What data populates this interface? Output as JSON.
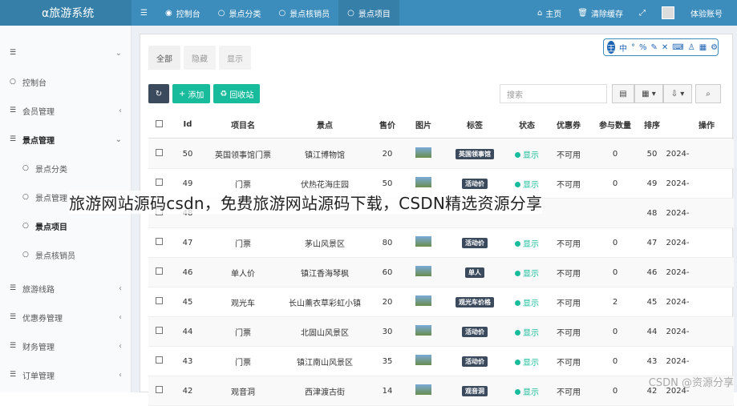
{
  "header": {
    "logo": "α旅游系统",
    "nav": [
      {
        "icon": "dashboard-icon",
        "label": "控制台"
      },
      {
        "icon": "circle-icon",
        "label": "景点分类"
      },
      {
        "icon": "circle-icon",
        "label": "景点核销员"
      },
      {
        "icon": "circle-icon",
        "label": "景点项目"
      }
    ],
    "right": {
      "home": "主页",
      "clear_cache": "清除缓存",
      "account": "体验账号"
    }
  },
  "sidebar": {
    "items": [
      {
        "label": "控制台"
      },
      {
        "label": "会员管理"
      },
      {
        "label": "景点管理"
      },
      {
        "label": "景点分类"
      },
      {
        "label": "景点管理"
      },
      {
        "label": "景点项目"
      },
      {
        "label": "景点核销员"
      },
      {
        "label": "旅游线路"
      },
      {
        "label": "优惠券管理"
      },
      {
        "label": "财务管理"
      },
      {
        "label": "订单管理"
      }
    ]
  },
  "tabs": [
    "全部",
    "隐藏",
    "显示"
  ],
  "toolbar": {
    "add": "添加",
    "recycle": "回收站",
    "search_placeholder": "搜索"
  },
  "table": {
    "headers": [
      "Id",
      "项目名",
      "景点",
      "售价",
      "图片",
      "标签",
      "状态",
      "优惠券",
      "参与数量",
      "排序",
      "操作"
    ],
    "rows": [
      {
        "id": "50",
        "name": "英国领事馆门票",
        "spot": "镇江博物馆",
        "price": "20",
        "tag": "英国领事馆",
        "status": "显示",
        "coupon": "不可用",
        "count": "0",
        "sort": "50",
        "time": "2024-"
      },
      {
        "id": "49",
        "name": "门票",
        "spot": "伏热花海庄园",
        "price": "50",
        "tag": "活动价",
        "status": "显示",
        "coupon": "不可用",
        "count": "0",
        "sort": "49",
        "time": "2024-"
      },
      {
        "id": "48",
        "name": "",
        "spot": "",
        "price": "",
        "tag": "",
        "status": "",
        "coupon": "",
        "count": "",
        "sort": "48",
        "time": "2024-"
      },
      {
        "id": "47",
        "name": "门票",
        "spot": "茅山风景区",
        "price": "80",
        "tag": "活动价",
        "status": "显示",
        "coupon": "不可用",
        "count": "0",
        "sort": "47",
        "time": "2024-"
      },
      {
        "id": "46",
        "name": "单人价",
        "spot": "镇江香海琴枫",
        "price": "60",
        "tag": "单人",
        "status": "显示",
        "coupon": "不可用",
        "count": "0",
        "sort": "46",
        "time": "2024-"
      },
      {
        "id": "45",
        "name": "观光车",
        "spot": "长山薰衣草彩虹小镇",
        "price": "20",
        "tag": "观光车价格",
        "status": "显示",
        "coupon": "不可用",
        "count": "2",
        "sort": "45",
        "time": "2024-"
      },
      {
        "id": "44",
        "name": "门票",
        "spot": "北固山风景区",
        "price": "30",
        "tag": "活动价",
        "status": "显示",
        "coupon": "不可用",
        "count": "0",
        "sort": "44",
        "time": "2024-"
      },
      {
        "id": "43",
        "name": "门票",
        "spot": "镇江南山风景区",
        "price": "35",
        "tag": "活动价",
        "status": "显示",
        "coupon": "不可用",
        "count": "0",
        "sort": "43",
        "time": "2024-"
      },
      {
        "id": "42",
        "name": "观音洞",
        "spot": "西津渡古街",
        "price": "14",
        "tag": "观音洞",
        "status": "显示",
        "coupon": "不可用",
        "count": "0",
        "sort": "42",
        "time": "2024-"
      }
    ]
  },
  "floatbar": {
    "items": [
      "中"
    ]
  },
  "overlay_title": "旅游网站源码csdn，免费旅游网站源码下载，CSDN精选资源分享",
  "watermark": "CSDN @资源分享"
}
